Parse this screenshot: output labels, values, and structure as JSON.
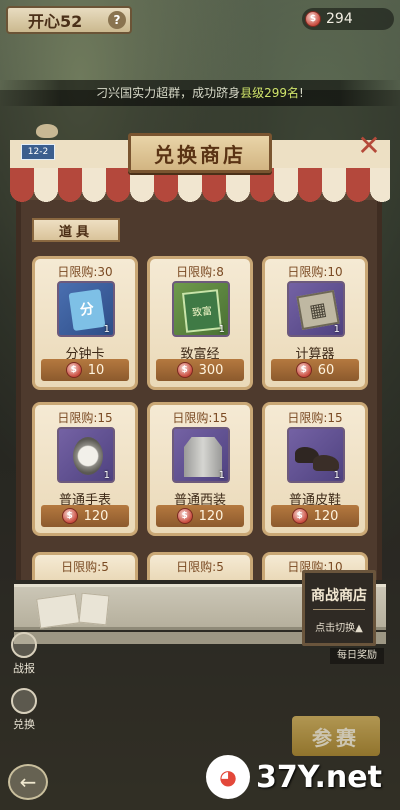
{
  "header": {
    "title": "开心52",
    "help_icon": "?",
    "currency_icon": "coin-icon",
    "currency_amount": "294"
  },
  "ticker": {
    "prefix": "刁兴国实力超群，成功跻身",
    "highlight": "县级299名",
    "suffix": "!"
  },
  "shop": {
    "title": "兑换商店",
    "close_icon": "✕",
    "house_number": "12-2",
    "category": "道具",
    "items": [
      {
        "limit": "日限购:30",
        "name": "分钟卡",
        "qty": "1",
        "price": "10",
        "icon": "minute-card-icon",
        "icon_glyph": "分"
      },
      {
        "limit": "日限购:8",
        "name": "致富经",
        "qty": "1",
        "price": "300",
        "icon": "wealth-book-icon",
        "icon_glyph": "致富"
      },
      {
        "limit": "日限购:10",
        "name": "计算器",
        "qty": "1",
        "price": "60",
        "icon": "calculator-icon",
        "icon_glyph": "▦"
      },
      {
        "limit": "日限购:15",
        "name": "普通手表",
        "qty": "1",
        "price": "120",
        "icon": "watch-icon",
        "icon_glyph": "⌚"
      },
      {
        "limit": "日限购:15",
        "name": "普通西装",
        "qty": "1",
        "price": "120",
        "icon": "suit-icon",
        "icon_glyph": "♜"
      },
      {
        "limit": "日限购:15",
        "name": "普通皮鞋",
        "qty": "1",
        "price": "120",
        "icon": "shoes-icon",
        "icon_glyph": "👞"
      }
    ],
    "partial_items": [
      {
        "limit": "日限购:5"
      },
      {
        "limit": "日限购:5"
      },
      {
        "limit": "日限购:10"
      }
    ]
  },
  "side_sign": {
    "title": "商战商店",
    "action": "点击切换▲"
  },
  "left_buttons": [
    {
      "label": "战报"
    },
    {
      "label": "兑换"
    }
  ],
  "daily_label": "每日奖励",
  "join_button": "参赛",
  "back_icon": "←",
  "watermark": {
    "text": "37Y.net"
  }
}
